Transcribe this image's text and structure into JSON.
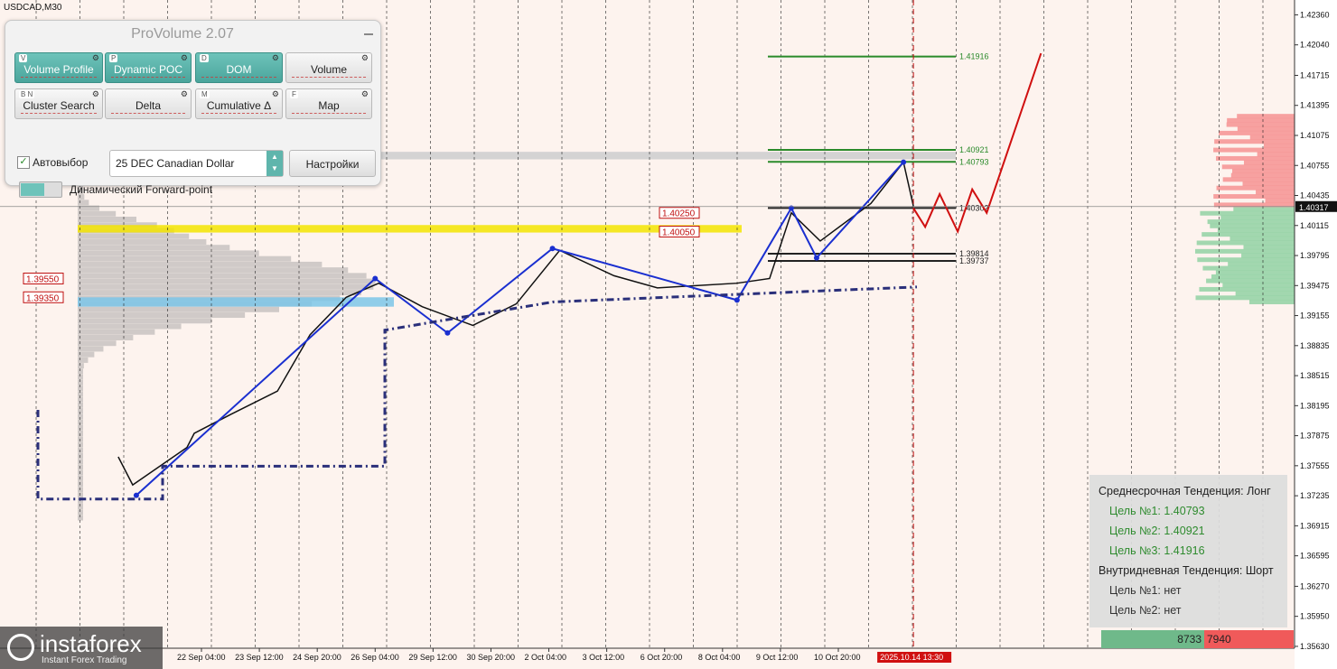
{
  "symbol": "USDCAD,M30",
  "panel": {
    "title": "ProVolume 2.07",
    "buttons": [
      {
        "key": "V",
        "label": "Volume Profile",
        "style": "teal"
      },
      {
        "key": "P",
        "label": "Dynamic POC",
        "style": "teal"
      },
      {
        "key": "D",
        "label": "DOM",
        "style": "teal"
      },
      {
        "key": "",
        "label": "Volume",
        "style": "gray"
      },
      {
        "key": "B N",
        "label": "Cluster Search",
        "style": "gray"
      },
      {
        "key": "",
        "label": "Delta",
        "style": "gray"
      },
      {
        "key": "M",
        "label": "Cumulative Δ",
        "style": "gray"
      },
      {
        "key": "F",
        "label": "Map",
        "style": "gray"
      }
    ],
    "autoselect_label": "Автовыбор",
    "autoselect_checked": true,
    "instrument": "25 DEC Canadian Dollar",
    "settings_label": "Настройки",
    "forward_label": "Динамический Forward-point"
  },
  "trend_box": {
    "medium_title": "Среднесрочная Тенденция: Лонг",
    "medium_targets": [
      "Цель №1: 1.40793",
      "Цель №2: 1.40921",
      "Цель №3: 1.41916"
    ],
    "intraday_title": "Внутридневная Тенденция: Шорт",
    "intraday_targets": [
      "Цель №1: нет",
      "Цель №2: нет"
    ]
  },
  "volume_bar": {
    "buy": "8733",
    "sell": "7940",
    "buy_color": "#6fb98a",
    "sell_color": "#f05a5a"
  },
  "logo": {
    "name": "instaforex",
    "tagline": "Instant Forex Trading"
  },
  "chart_data": {
    "type": "line",
    "symbol": "USDCAD",
    "timeframe": "M30",
    "ylim": [
      1.3561,
      1.4247
    ],
    "y_ticks": [
      "1.42360",
      "1.42040",
      "1.41715",
      "1.41395",
      "1.41075",
      "1.40755",
      "1.40435",
      "1.40115",
      "1.39795",
      "1.39475",
      "1.39155",
      "1.38835",
      "1.38515",
      "1.38195",
      "1.37875",
      "1.37555",
      "1.37235",
      "1.36915",
      "1.36595",
      "1.36270",
      "1.35950",
      "1.35630"
    ],
    "x_ticks": [
      "22 Sep 04:00",
      "23 Sep 12:00",
      "24 Sep 20:00",
      "26 Sep 04:00",
      "29 Sep 12:00",
      "30 Sep 20:00",
      "2 Oct 04:00",
      "3 Oct 12:00",
      "6 Oct 20:00",
      "8 Oct 04:00",
      "9 Oct 12:00",
      "10 Oct 20:00"
    ],
    "current_time_label": "2025.10.14 13:30",
    "current_price": "1.40317",
    "price_path": [
      {
        "x": "18 Sep 06:00",
        "y": 1.3765
      },
      {
        "x": "18 Sep 14:00",
        "y": 1.3735
      },
      {
        "x": "19 Sep 20:00",
        "y": 1.3775
      },
      {
        "x": "21 Sep 22:00",
        "y": 1.379
      },
      {
        "x": "22 Sep 20:00",
        "y": 1.381
      },
      {
        "x": "23 Sep 22:00",
        "y": 1.3835
      },
      {
        "x": "24 Sep 16:00",
        "y": 1.3895
      },
      {
        "x": "25 Sep 12:00",
        "y": 1.3935
      },
      {
        "x": "26 Sep 06:00",
        "y": 1.395
      },
      {
        "x": "29 Sep 06:00",
        "y": 1.3925
      },
      {
        "x": "30 Sep 10:00",
        "y": 1.3905
      },
      {
        "x": "1 Oct 10:00",
        "y": 1.3928
      },
      {
        "x": "2 Oct 10:00",
        "y": 1.3985
      },
      {
        "x": "3 Oct 16:00",
        "y": 1.3958
      },
      {
        "x": "6 Oct 16:00",
        "y": 1.3945
      },
      {
        "x": "8 Oct 12:00",
        "y": 1.395
      },
      {
        "x": "9 Oct 06:00",
        "y": 1.3955
      },
      {
        "x": "9 Oct 18:00",
        "y": 1.4025
      },
      {
        "x": "10 Oct 10:00",
        "y": 1.3995
      },
      {
        "x": "13 Oct 14:00",
        "y": 1.4035
      },
      {
        "x": "14 Oct 08:00",
        "y": 1.4079
      },
      {
        "x": "14 Oct 13:30",
        "y": 1.4032
      }
    ],
    "zigzag": [
      {
        "x": "18 Sep 16:00",
        "y": 1.3724
      },
      {
        "x": "26 Sep 04:00",
        "y": 1.3955
      },
      {
        "x": "29 Sep 20:00",
        "y": 1.3897
      },
      {
        "x": "2 Oct 06:00",
        "y": 1.3987
      },
      {
        "x": "8 Oct 12:00",
        "y": 1.3932
      },
      {
        "x": "9 Oct 18:00",
        "y": 1.403
      },
      {
        "x": "10 Oct 08:00",
        "y": 1.3977
      },
      {
        "x": "14 Oct 08:00",
        "y": 1.4079
      }
    ],
    "forecast": [
      {
        "x": "14 Oct 13:30",
        "y": 1.403
      },
      {
        "x": "14 Oct 20:00",
        "y": 1.401
      },
      {
        "x": "15 Oct 04:00",
        "y": 1.4045
      },
      {
        "x": "15 Oct 14:00",
        "y": 1.4005
      },
      {
        "x": "15 Oct 22:00",
        "y": 1.405
      },
      {
        "x": "16 Oct 06:00",
        "y": 1.4025
      },
      {
        "x": "17 Oct 12:00",
        "y": 1.4195
      }
    ],
    "levels": [
      {
        "label": "1.41916",
        "value": 1.41916,
        "color": "#2a8a2a"
      },
      {
        "label": "1.40921",
        "value": 1.40921,
        "color": "#2a8a2a"
      },
      {
        "label": "1.40793",
        "value": 1.40793,
        "color": "#2a8a2a"
      },
      {
        "label": "1.40302",
        "value": 1.40302,
        "color": "#222222"
      },
      {
        "label": "1.39814",
        "value": 1.39814,
        "color": "#222222"
      },
      {
        "label": "1.39737",
        "value": 1.39737,
        "color": "#222222"
      }
    ],
    "tags": [
      {
        "label": "1.40250",
        "value": 1.4025
      },
      {
        "label": "1.40050",
        "value": 1.4005
      },
      {
        "label": "1.39550",
        "value": 1.3955
      },
      {
        "label": "1.39350",
        "value": 1.3935
      }
    ],
    "grid": true
  }
}
